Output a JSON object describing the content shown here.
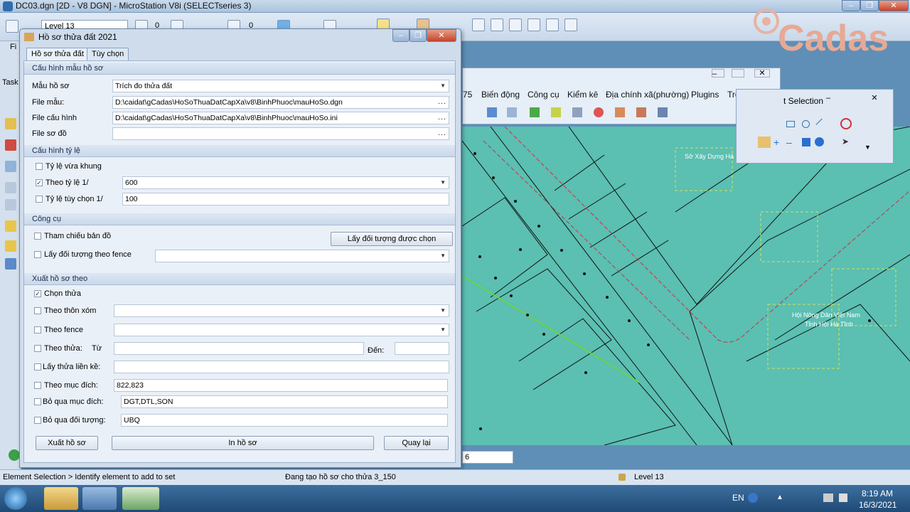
{
  "app": {
    "title": "DC03.dgn [2D - V8 DGN] - MicroStation V8i (SELECTseries 3)",
    "level": "Level 13",
    "zero": "0"
  },
  "brand": {
    "text": "Cadas"
  },
  "left_labels": {
    "task": "Task",
    "f": "Fi"
  },
  "dialog": {
    "title": "Hồ sơ thửa đất 2021",
    "tabs": [
      "Hồ sơ thửa đất",
      "Tùy chọn"
    ],
    "sec1": {
      "title": "Cấu hình mẫu hồ sơ",
      "mau_label": "Mẫu hồ sơ",
      "mau_value": "Trích đo thửa đất",
      "file_mau_label": "File mẫu:",
      "file_mau_value": "D:\\caidat\\gCadas\\HoSoThuaDatCapXa\\v8\\BinhPhuoc\\mauHoSo.dgn",
      "file_cauhinh_label": "File cấu hình",
      "file_cauhinh_value": "D:\\caidat\\gCadas\\HoSoThuaDatCapXa\\v8\\BinhPhuoc\\mauHoSo.ini",
      "file_sodo_label": "File sơ đồ",
      "file_sodo_value": "",
      "dots": "..."
    },
    "sec2": {
      "title": "Cấu hình tỷ lệ",
      "vua_khung": "Tỷ lệ vừa khung",
      "theo_ty_le": "Theo tỷ lệ 1/",
      "theo_ty_le_value": "600",
      "tuy_chon": "Tỷ lệ tùy chọn 1/",
      "tuy_chon_value": "100"
    },
    "sec3": {
      "title": "Công cụ",
      "tham_chieu": "Tham chiếu bản đồ",
      "lay_doi_tuong_btn": "Lấy đối tượng được chọn",
      "lay_fence": "Lấy đối tượng theo fence"
    },
    "sec4": {
      "title": "Xuất hồ sơ theo",
      "chon_thua": "Chọn thửa",
      "thon_xom": "Theo thôn xóm",
      "fence": "Theo fence",
      "theo_thua": "Theo thửa:",
      "tu": "Từ",
      "den": "Đến:",
      "lien_ke": "Lấy thửa liền kề:",
      "muc_dich": "Theo mục đích:",
      "muc_dich_value": "822,823",
      "bo_qua_md": "Bỏ qua mục đích:",
      "bo_qua_md_value": "DGT,DTL,SON",
      "bo_qua_dt": "Bỏ qua đối tượng:",
      "bo_qua_dt_value": "UBQ"
    },
    "buttons": {
      "xuat": "Xuất hồ sơ",
      "in": "In hồ sơ",
      "quay_lai": "Quay lại"
    }
  },
  "submenu": [
    "75",
    "Biến động",
    "Công cụ",
    "Kiểm kê",
    "Địa chính xã(phường)",
    "Plugins",
    "Trợ giúp"
  ],
  "element_selection": {
    "title": "t Selection"
  },
  "map_labels": [
    "Sở Xây Dựng Hà",
    "Hội Nông Dân Việt Nam",
    "Tỉnh Hội Hà Tĩnh"
  ],
  "coord_value": "6",
  "status": {
    "left": "Element Selection > Identify element to add to set",
    "mid": "Đang tạo hồ sơ cho thửa 3_150",
    "level": "Level 13"
  },
  "taskbar": {
    "lang": "EN",
    "time": "8:19 AM",
    "date": "16/3/2021"
  }
}
